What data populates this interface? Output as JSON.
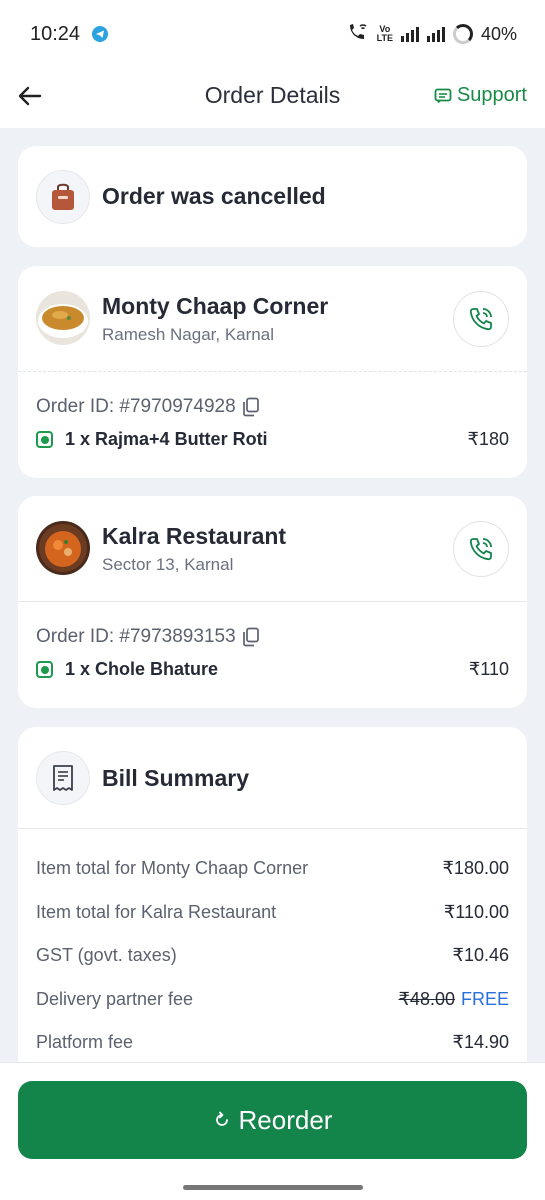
{
  "status_bar": {
    "time": "10:24",
    "battery": "40%",
    "lte_top": "Vo",
    "lte_bottom": "LTE"
  },
  "header": {
    "title": "Order Details",
    "support_label": "Support"
  },
  "order_status": {
    "text": "Order was cancelled"
  },
  "restaurants": [
    {
      "name": "Monty Chaap Corner",
      "location": "Ramesh Nagar, Karnal",
      "order_id": "Order ID: #7970974928",
      "item": "1 x Rajma+4 Butter Roti",
      "price": "₹180"
    },
    {
      "name": "Kalra Restaurant",
      "location": "Sector 13, Karnal",
      "order_id": "Order ID: #7973893153",
      "item": "1 x Chole Bhature",
      "price": "₹110"
    }
  ],
  "bill": {
    "title": "Bill Summary",
    "rows": [
      {
        "label": "Item total for Monty Chaap Corner",
        "value": "₹180.00"
      },
      {
        "label": "Item total for Kalra Restaurant",
        "value": "₹110.00"
      },
      {
        "label": "GST (govt. taxes)",
        "value": "₹10.46"
      },
      {
        "label": "Delivery partner fee",
        "value": "₹48.00",
        "extra": "FREE"
      },
      {
        "label": "Platform fee",
        "value": "₹14.90"
      }
    ]
  },
  "footer": {
    "reorder_label": "Reorder"
  },
  "colors": {
    "accent_green": "#13844a",
    "free_blue": "#2a6fdb",
    "background": "#eef1f6"
  }
}
